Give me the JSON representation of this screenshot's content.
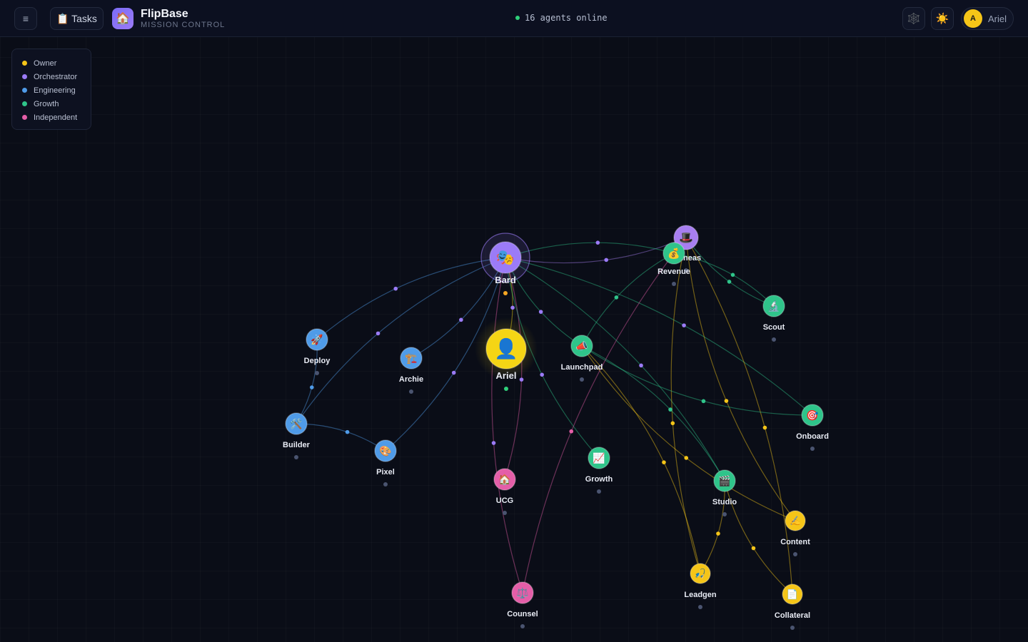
{
  "header": {
    "menu_icon": "hamburger-icon",
    "tasks_label": "📋 Tasks",
    "logo_icon": "🏠",
    "app_title": "FlipBase",
    "app_subtitle": "MISSION CONTROL",
    "status_text": "16 agents online",
    "status_color": "#2fd07a",
    "network_icon": "🕸️",
    "theme_icon": "☀️",
    "user_initial": "A",
    "user_name": "Ariel"
  },
  "legend": [
    {
      "label": "Owner",
      "color": "#f5c518"
    },
    {
      "label": "Orchestrator",
      "color": "#9b7bf7"
    },
    {
      "label": "Engineering",
      "color": "#4f9be8"
    },
    {
      "label": "Growth",
      "color": "#2fc48a"
    },
    {
      "label": "Independent",
      "color": "#e45ea8"
    }
  ],
  "nodes": [
    {
      "id": "bard",
      "label": "Bard",
      "icon": "🎭",
      "group": "Orchestrator",
      "color": "#9b7bf7"
    },
    {
      "id": "ariel",
      "label": "Ariel",
      "icon": "👤",
      "group": "Owner",
      "color": "#f5d515"
    },
    {
      "id": "phineas",
      "label": "Phineas",
      "icon": "🎩",
      "group": "Orchestrator",
      "color": "#a77ef0"
    },
    {
      "id": "revenue",
      "label": "Revenue",
      "icon": "💰",
      "group": "Growth",
      "color": "#2fc48a"
    },
    {
      "id": "scout",
      "label": "Scout",
      "icon": "🔬",
      "group": "Growth",
      "color": "#2fc48a"
    },
    {
      "id": "deploy",
      "label": "Deploy",
      "icon": "🚀",
      "group": "Engineering",
      "color": "#4f9be8"
    },
    {
      "id": "archie",
      "label": "Archie",
      "icon": "🏗️",
      "group": "Engineering",
      "color": "#4f9be8"
    },
    {
      "id": "launchpad",
      "label": "Launchpad",
      "icon": "📣",
      "group": "Growth",
      "color": "#2fc48a"
    },
    {
      "id": "builder",
      "label": "Builder",
      "icon": "🛠️",
      "group": "Engineering",
      "color": "#4f9be8"
    },
    {
      "id": "pixel",
      "label": "Pixel",
      "icon": "🎨",
      "group": "Engineering",
      "color": "#4f9be8"
    },
    {
      "id": "onboard",
      "label": "Onboard",
      "icon": "🎯",
      "group": "Growth",
      "color": "#2fc48a"
    },
    {
      "id": "growth",
      "label": "Growth",
      "icon": "📈",
      "group": "Growth",
      "color": "#2fc48a"
    },
    {
      "id": "ugc",
      "label": "UCG",
      "icon": "🏠",
      "group": "Independent",
      "color": "#e45ea8"
    },
    {
      "id": "studio",
      "label": "Studio",
      "icon": "🎬",
      "group": "Growth",
      "color": "#2fc48a"
    },
    {
      "id": "content",
      "label": "Content",
      "icon": "✍️",
      "group": "Owner",
      "color": "#f5c518"
    },
    {
      "id": "leadgen",
      "label": "Leadgen",
      "icon": "🎣",
      "group": "Owner",
      "color": "#f5c518"
    },
    {
      "id": "collateral",
      "label": "Collateral",
      "icon": "📄",
      "group": "Owner",
      "color": "#f5c518"
    },
    {
      "id": "counsel",
      "label": "Counsel",
      "icon": "⚖️",
      "group": "Independent",
      "color": "#e45ea8"
    }
  ],
  "edges": [
    [
      "bard",
      "ariel"
    ],
    [
      "bard",
      "phineas"
    ],
    [
      "bard",
      "revenue"
    ],
    [
      "bard",
      "deploy"
    ],
    [
      "bard",
      "archie"
    ],
    [
      "bard",
      "builder"
    ],
    [
      "bard",
      "pixel"
    ],
    [
      "bard",
      "launchpad"
    ],
    [
      "bard",
      "ugc"
    ],
    [
      "bard",
      "counsel"
    ],
    [
      "bard",
      "onboard"
    ],
    [
      "bard",
      "growth"
    ],
    [
      "bard",
      "studio"
    ],
    [
      "revenue",
      "launchpad"
    ],
    [
      "revenue",
      "scout"
    ],
    [
      "phineas",
      "content"
    ],
    [
      "phineas",
      "collateral"
    ],
    [
      "phineas",
      "leadgen"
    ],
    [
      "launchpad",
      "studio"
    ],
    [
      "launchpad",
      "content"
    ],
    [
      "launchpad",
      "leadgen"
    ],
    [
      "launchpad",
      "onboard"
    ],
    [
      "builder",
      "pixel"
    ],
    [
      "studio",
      "collateral"
    ],
    [
      "studio",
      "leadgen"
    ],
    [
      "revenue",
      "counsel"
    ],
    [
      "deploy",
      "builder"
    ],
    [
      "phineas",
      "scout"
    ]
  ]
}
